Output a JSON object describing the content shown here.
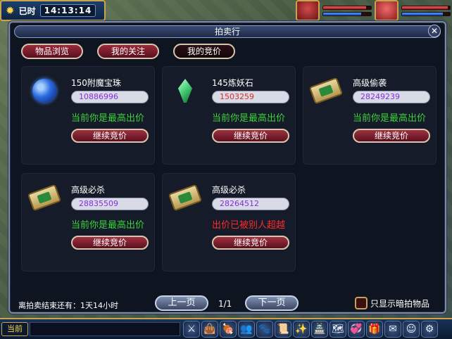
{
  "hud": {
    "clock_label": "已时",
    "clock_time": "14:13:14"
  },
  "window": {
    "title": "拍卖行",
    "close_glyph": "✕"
  },
  "tabs": [
    {
      "label": "物品浏览",
      "active": false
    },
    {
      "label": "我的关注",
      "active": false
    },
    {
      "label": "我的竞价",
      "active": true
    }
  ],
  "items": [
    {
      "name": "150附魔宝珠",
      "price": "10886996",
      "price_color": "#8a2ae0",
      "status": "当前你是最高出价",
      "status_type": "ok",
      "button": "继续竞价",
      "icon": "blue-orb-icon"
    },
    {
      "name": "145炼妖石",
      "price": "1503259",
      "price_color": "#e02a2a",
      "status": "当前你是最高出价",
      "status_type": "ok",
      "button": "继续竞价",
      "icon": "green-gem-icon"
    },
    {
      "name": "高级偷袭",
      "price": "28249239",
      "price_color": "#8a2ae0",
      "status": "当前你是最高出价",
      "status_type": "ok",
      "button": "继续竞价",
      "icon": "skill-book-icon"
    },
    {
      "name": "高级必杀",
      "price": "28835509",
      "price_color": "#8a2ae0",
      "status": "当前你是最高出价",
      "status_type": "ok",
      "button": "继续竞价",
      "icon": "skill-book-icon"
    },
    {
      "name": "高级必杀",
      "price": "28264512",
      "price_color": "#8a2ae0",
      "status": "出价已被别人超越",
      "status_type": "bad",
      "button": "继续竞价",
      "icon": "skill-book-icon"
    }
  ],
  "footer": {
    "remaining": "离拍卖结束还有：1天14小时",
    "prev": "上一页",
    "page": "1/1",
    "next": "下一页",
    "filter": "只显示暗拍物品"
  },
  "bottom": {
    "channel": "当前"
  },
  "colors": {
    "status_ok": "#3ad23a",
    "status_bad": "#ff2a2a"
  }
}
